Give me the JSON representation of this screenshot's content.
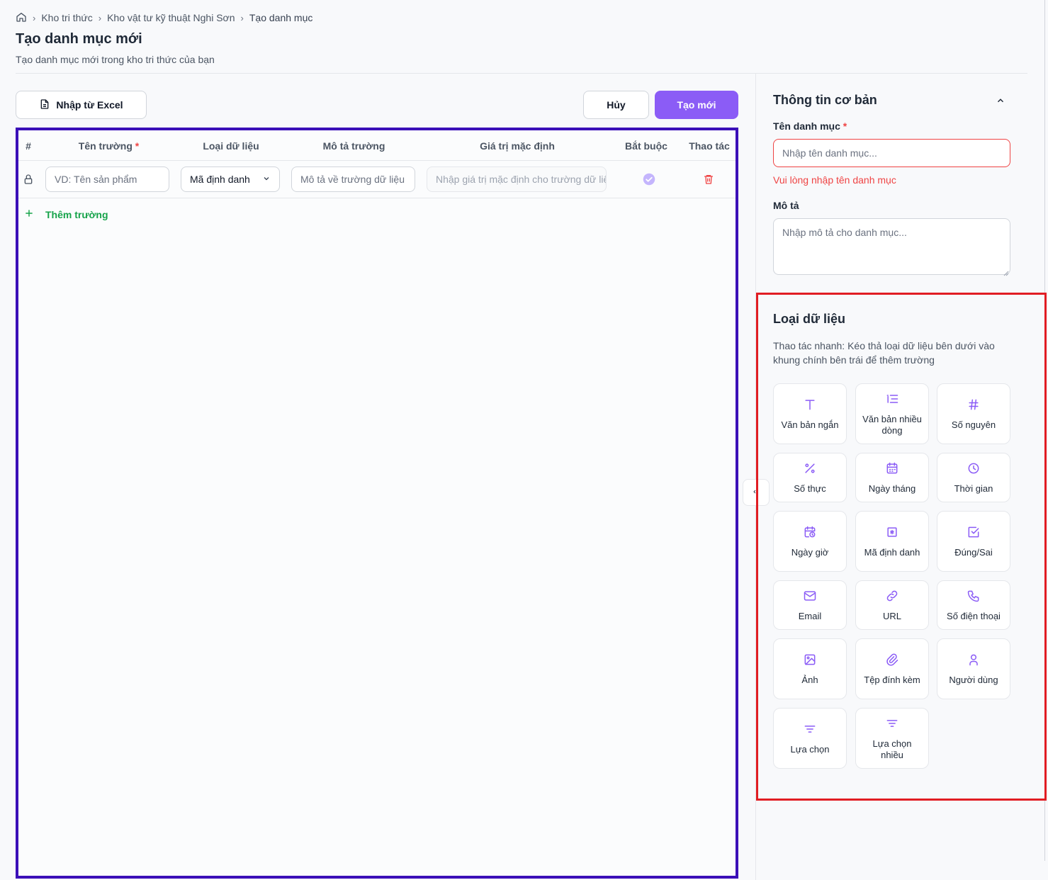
{
  "breadcrumb": {
    "items": [
      "Kho tri thức",
      "Kho vật tư kỹ thuật Nghi Sơn",
      "Tạo danh mục"
    ]
  },
  "header": {
    "title": "Tạo danh mục mới",
    "subtitle": "Tạo danh mục mới trong kho tri thức của bạn"
  },
  "toolbar": {
    "import_label": "Nhập từ Excel",
    "cancel_label": "Hủy",
    "create_label": "Tạo mới"
  },
  "table": {
    "columns": {
      "index": "#",
      "name": "Tên trường",
      "type": "Loại dữ liệu",
      "desc": "Mô tả trường",
      "default": "Giá trị mặc định",
      "required": "Bắt buộc",
      "actions": "Thao tác"
    },
    "row": {
      "name_placeholder": "VD: Tên sản phẩm",
      "type_value": "Mã định danh",
      "desc_placeholder": "Mô tả về trường dữ liệu",
      "default_placeholder": "Nhập giá trị mặc định cho trường dữ liệu"
    },
    "add_field_label": "Thêm trường"
  },
  "basic_info": {
    "title": "Thông tin cơ bản",
    "name_label": "Tên danh mục",
    "name_placeholder": "Nhập tên danh mục...",
    "name_error": "Vui lòng nhập tên danh mục",
    "desc_label": "Mô tả",
    "desc_placeholder": "Nhập mô tả cho danh mục..."
  },
  "data_types": {
    "title": "Loại dữ liệu",
    "hint": "Thao tác nhanh: Kéo thả loại dữ liệu bên dưới vào khung chính bên trái để thêm trường",
    "items": [
      {
        "label": "Văn bản ngắn",
        "icon": "text-icon"
      },
      {
        "label": "Văn bản nhiều dòng",
        "icon": "multiline-icon"
      },
      {
        "label": "Số nguyên",
        "icon": "hash-icon"
      },
      {
        "label": "Số thực",
        "icon": "percent-icon"
      },
      {
        "label": "Ngày tháng",
        "icon": "calendar-icon"
      },
      {
        "label": "Thời gian",
        "icon": "clock-icon"
      },
      {
        "label": "Ngày giờ",
        "icon": "calendar-clock-icon"
      },
      {
        "label": "Mã định danh",
        "icon": "id-icon"
      },
      {
        "label": "Đúng/Sai",
        "icon": "checkbox-icon"
      },
      {
        "label": "Email",
        "icon": "mail-icon"
      },
      {
        "label": "URL",
        "icon": "link-icon"
      },
      {
        "label": "Số điện thoại",
        "icon": "phone-icon"
      },
      {
        "label": "Ảnh",
        "icon": "image-icon"
      },
      {
        "label": "Tệp đính kèm",
        "icon": "paperclip-icon"
      },
      {
        "label": "Người dùng",
        "icon": "user-icon"
      },
      {
        "label": "Lựa chọn",
        "icon": "filter-icon"
      },
      {
        "label": "Lựa chọn nhiều",
        "icon": "filter-multi-icon"
      }
    ]
  },
  "colors": {
    "accent": "#8b5cf6",
    "error": "#ef4444",
    "success": "#16a34a"
  }
}
